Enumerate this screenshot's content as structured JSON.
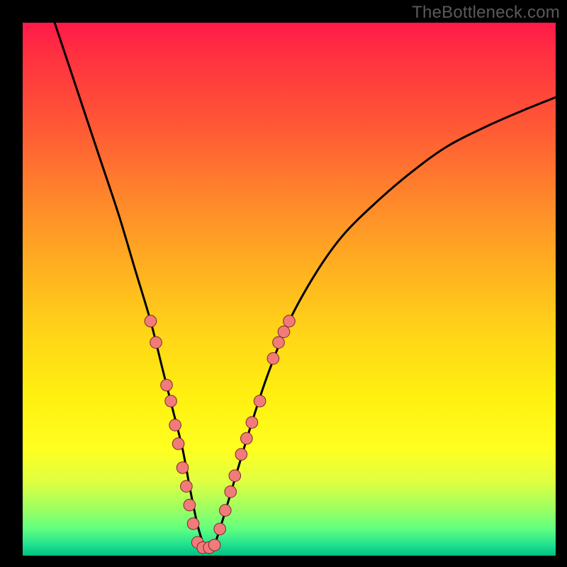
{
  "watermark": "TheBottleneck.com",
  "chart_data": {
    "type": "line",
    "title": "",
    "xlabel": "",
    "ylabel": "",
    "xlim": [
      0,
      100
    ],
    "ylim": [
      0,
      100
    ],
    "grid": false,
    "series": [
      {
        "name": "curve",
        "x": [
          6,
          10,
          14,
          18,
          21,
          24,
          26,
          28,
          30,
          31.5,
          33,
          34.5,
          35.5,
          37,
          40,
          43,
          46,
          50,
          55,
          60,
          66,
          73,
          80,
          88,
          95,
          100
        ],
        "y": [
          100,
          88,
          76,
          64,
          54,
          44,
          36,
          28,
          20,
          12,
          5,
          1,
          1,
          5,
          15,
          25,
          34,
          44,
          53,
          60,
          66,
          72,
          77,
          81,
          84,
          86
        ]
      }
    ],
    "markers": [
      {
        "x": 24.0,
        "y": 44.0
      },
      {
        "x": 25.0,
        "y": 40.0
      },
      {
        "x": 27.0,
        "y": 32.0
      },
      {
        "x": 27.8,
        "y": 29.0
      },
      {
        "x": 28.6,
        "y": 24.5
      },
      {
        "x": 29.2,
        "y": 21.0
      },
      {
        "x": 30.0,
        "y": 16.5
      },
      {
        "x": 30.7,
        "y": 13.0
      },
      {
        "x": 31.3,
        "y": 9.5
      },
      {
        "x": 32.0,
        "y": 6.0
      },
      {
        "x": 32.8,
        "y": 2.5
      },
      {
        "x": 33.8,
        "y": 1.5
      },
      {
        "x": 35.0,
        "y": 1.5
      },
      {
        "x": 36.0,
        "y": 2.0
      },
      {
        "x": 37.0,
        "y": 5.0
      },
      {
        "x": 38.0,
        "y": 8.5
      },
      {
        "x": 39.0,
        "y": 12.0
      },
      {
        "x": 39.8,
        "y": 15.0
      },
      {
        "x": 41.0,
        "y": 19.0
      },
      {
        "x": 42.0,
        "y": 22.0
      },
      {
        "x": 43.0,
        "y": 25.0
      },
      {
        "x": 44.5,
        "y": 29.0
      },
      {
        "x": 47.0,
        "y": 37.0
      },
      {
        "x": 48.0,
        "y": 40.0
      },
      {
        "x": 49.0,
        "y": 42.0
      },
      {
        "x": 50.0,
        "y": 44.0
      }
    ],
    "marker_style": {
      "fill": "#f27a7a",
      "stroke": "#7a2a2a",
      "r_pct": 1.1
    },
    "curve_stroke": "#000000",
    "curve_width": 3
  }
}
